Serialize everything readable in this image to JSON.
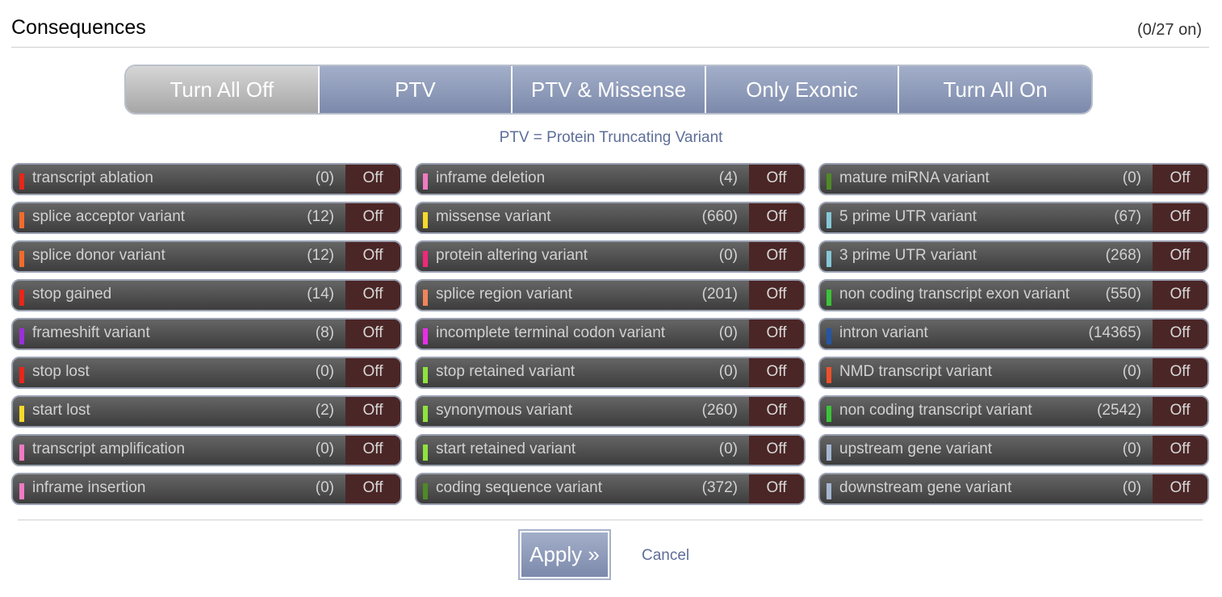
{
  "header": {
    "title": "Consequences",
    "count": "(0/27 on)"
  },
  "presets": [
    {
      "label": "Turn All Off",
      "active": true
    },
    {
      "label": "PTV",
      "active": false
    },
    {
      "label": "PTV & Missense",
      "active": false
    },
    {
      "label": "Only Exonic",
      "active": false
    },
    {
      "label": "Turn All On",
      "active": false
    }
  ],
  "note": "PTV = Protein Truncating Variant",
  "columns": [
    [
      {
        "name": "transcript ablation",
        "count": "(0)",
        "state": "Off",
        "color": "#e8261b"
      },
      {
        "name": "splice acceptor variant",
        "count": "(12)",
        "state": "Off",
        "color": "#f26b2c"
      },
      {
        "name": "splice donor variant",
        "count": "(12)",
        "state": "Off",
        "color": "#f26b2c"
      },
      {
        "name": "stop gained",
        "count": "(14)",
        "state": "Off",
        "color": "#e8261b"
      },
      {
        "name": "frameshift variant",
        "count": "(8)",
        "state": "Off",
        "color": "#9a2fd9"
      },
      {
        "name": "stop lost",
        "count": "(0)",
        "state": "Off",
        "color": "#e8261b"
      },
      {
        "name": "start lost",
        "count": "(2)",
        "state": "Off",
        "color": "#f7d92a"
      },
      {
        "name": "transcript amplification",
        "count": "(0)",
        "state": "Off",
        "color": "#f07ac2"
      },
      {
        "name": "inframe insertion",
        "count": "(0)",
        "state": "Off",
        "color": "#f07ac2"
      }
    ],
    [
      {
        "name": "inframe deletion",
        "count": "(4)",
        "state": "Off",
        "color": "#f07ac2"
      },
      {
        "name": "missense variant",
        "count": "(660)",
        "state": "Off",
        "color": "#f7d92a"
      },
      {
        "name": "protein altering variant",
        "count": "(0)",
        "state": "Off",
        "color": "#f0287a"
      },
      {
        "name": "splice region variant",
        "count": "(201)",
        "state": "Off",
        "color": "#f2845a"
      },
      {
        "name": "incomplete terminal codon variant",
        "count": "(0)",
        "state": "Off",
        "color": "#e92ee6"
      },
      {
        "name": "stop retained variant",
        "count": "(0)",
        "state": "Off",
        "color": "#8ee33c"
      },
      {
        "name": "synonymous variant",
        "count": "(260)",
        "state": "Off",
        "color": "#8ee33c"
      },
      {
        "name": "start retained variant",
        "count": "(0)",
        "state": "Off",
        "color": "#8ee33c"
      },
      {
        "name": "coding sequence variant",
        "count": "(372)",
        "state": "Off",
        "color": "#4e8a25"
      }
    ],
    [
      {
        "name": "mature miRNA variant",
        "count": "(0)",
        "state": "Off",
        "color": "#4e8a25"
      },
      {
        "name": "5 prime UTR variant",
        "count": "(67)",
        "state": "Off",
        "color": "#86c7d6"
      },
      {
        "name": "3 prime UTR variant",
        "count": "(268)",
        "state": "Off",
        "color": "#86c7d6"
      },
      {
        "name": "non coding transcript exon variant",
        "count": "(550)",
        "state": "Off",
        "color": "#3bc438"
      },
      {
        "name": "intron variant",
        "count": "(14365)",
        "state": "Off",
        "color": "#2456a6"
      },
      {
        "name": "NMD transcript variant",
        "count": "(0)",
        "state": "Off",
        "color": "#f0502a"
      },
      {
        "name": "non coding transcript variant",
        "count": "(2542)",
        "state": "Off",
        "color": "#3bc438"
      },
      {
        "name": "upstream gene variant",
        "count": "(0)",
        "state": "Off",
        "color": "#a6b6cf"
      },
      {
        "name": "downstream gene variant",
        "count": "(0)",
        "state": "Off",
        "color": "#a6b6cf"
      }
    ]
  ],
  "footer": {
    "apply_label": "Apply »",
    "cancel_label": "Cancel"
  }
}
